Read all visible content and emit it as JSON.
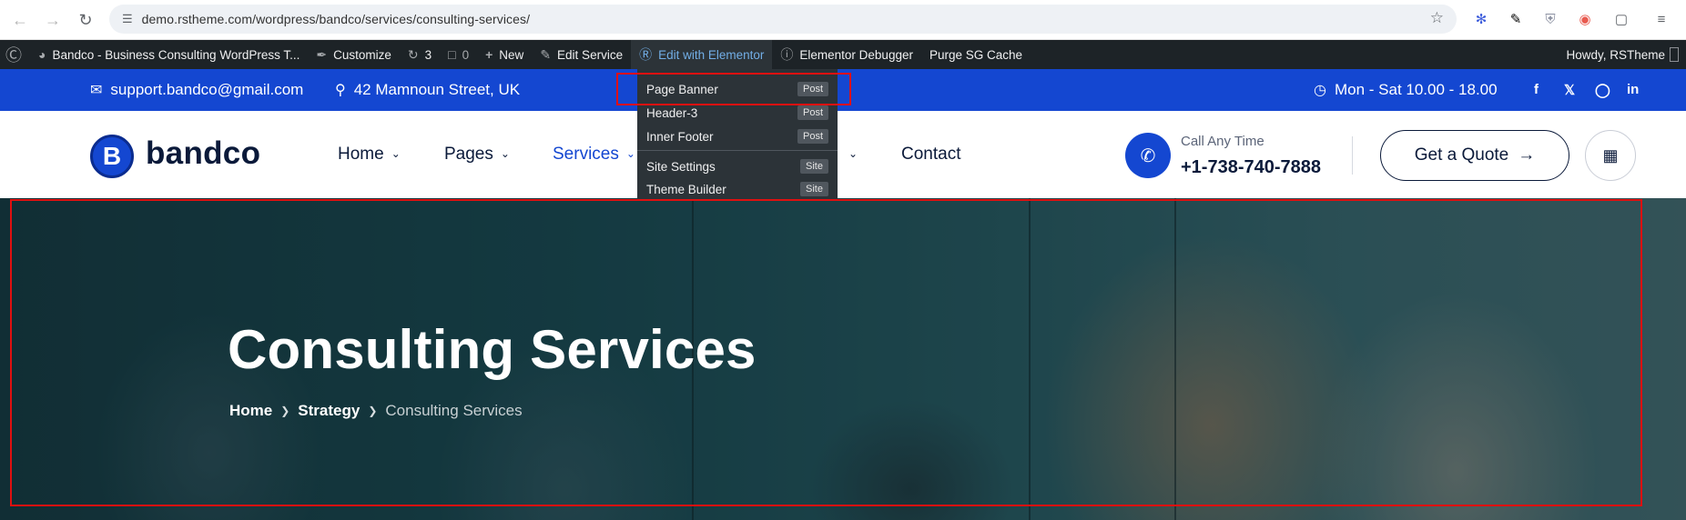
{
  "browser": {
    "url": "demo.rstheme.com/wordpress/bandco/services/consulting-services/"
  },
  "adminbar": {
    "site_name": "Bandco - Business Consulting WordPress T...",
    "customize": "Customize",
    "updates_count": "3",
    "comments_count": "0",
    "new": "New",
    "edit_service": "Edit Service",
    "edit_with_elementor": "Edit with Elementor",
    "elementor_debugger": "Elementor Debugger",
    "purge_cache": "Purge SG Cache",
    "howdy": "Howdy, RSTheme"
  },
  "elementor_menu": {
    "items": [
      {
        "label": "Page Banner",
        "badge": "Post"
      },
      {
        "label": "Header-3",
        "badge": "Post"
      },
      {
        "label": "Inner Footer",
        "badge": "Post"
      },
      {
        "label": "Site Settings",
        "badge": "Site"
      },
      {
        "label": "Theme Builder",
        "badge": "Site"
      }
    ]
  },
  "topbar": {
    "email": "support.bandco@gmail.com",
    "address": "42 Mamnoun Street, UK",
    "hours": "Mon - Sat 10.00 - 18.00",
    "social": [
      "facebook-icon",
      "x-icon",
      "instagram-icon",
      "linkedin-icon"
    ]
  },
  "header": {
    "logo_letter": "B",
    "logo_text": "bandco",
    "menu": {
      "home": "Home",
      "pages": "Pages",
      "services": "Services",
      "contact": "Contact"
    },
    "call_label": "Call Any Time",
    "call_number": "+1-738-740-7888",
    "quote_button": "Get a Quote"
  },
  "banner": {
    "title": "Consulting Services",
    "breadcrumb": {
      "home": "Home",
      "parent": "Strategy",
      "current": "Consulting Services"
    }
  },
  "colors": {
    "brand_blue": "#1447d1",
    "admin_bar": "#1d2327",
    "annotation_red": "#e01010"
  }
}
